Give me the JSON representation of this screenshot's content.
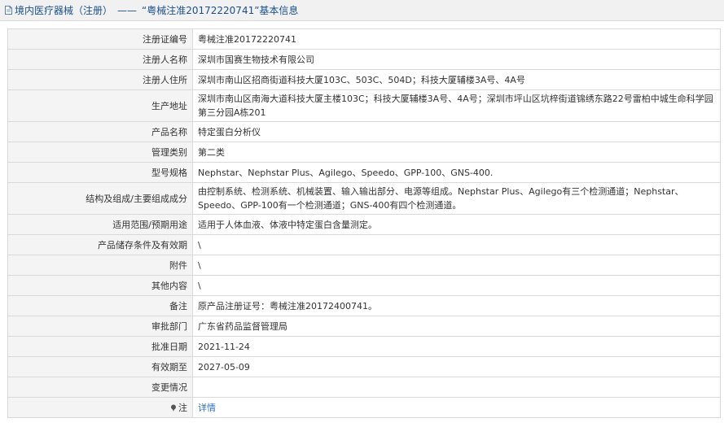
{
  "header": {
    "category": "境内医疗器械（注册）",
    "separator": "——",
    "record_title": "“粤械注准20172220741”基本信息"
  },
  "rows": [
    {
      "label": "注册证编号",
      "value": "粤械注准20172220741"
    },
    {
      "label": "注册人名称",
      "value": "深圳市国赛生物技术有限公司"
    },
    {
      "label": "注册人住所",
      "value": "深圳市南山区招商街道科技大厦103C、503C、504D；科技大厦辅楼3A号、4A号"
    },
    {
      "label": "生产地址",
      "value": "深圳市南山区南海大道科技大厦主楼103C；科技大厦辅楼3A号、4A号；深圳市坪山区坑梓街道锦绣东路22号雷柏中城生命科学园第三分园A栋201"
    },
    {
      "label": "产品名称",
      "value": "特定蛋白分析仪"
    },
    {
      "label": "管理类别",
      "value": "第二类"
    },
    {
      "label": "型号规格",
      "value": "Nephstar、Nephstar Plus、Agilego、Speedo、GPP-100、GNS-400."
    },
    {
      "label": "结构及组成/主要组成成分",
      "value": "由控制系统、检测系统、机械装置、输入输出部分、电源等组成。Nephstar Plus、Agilego有三个检测通道；Nephstar、Speedo、GPP-100有一个检测通道；GNS-400有四个检测通道。"
    },
    {
      "label": "适用范围/预期用途",
      "value": "适用于人体血液、体液中特定蛋白含量测定。"
    },
    {
      "label": "产品储存条件及有效期",
      "value": "\\"
    },
    {
      "label": "附件",
      "value": "\\"
    },
    {
      "label": "其他内容",
      "value": "\\"
    },
    {
      "label": "备注",
      "value": "原产品注册证号：粤械注准20172400741。"
    },
    {
      "label": "审批部门",
      "value": "广东省药品监督管理局"
    },
    {
      "label": "批准日期",
      "value": "2021-11-24"
    },
    {
      "label": "有效期至",
      "value": "2027-05-09"
    },
    {
      "label": "变更情况",
      "value": ""
    }
  ],
  "note_row": {
    "label": "注",
    "link_text": "详情"
  },
  "colors": {
    "header_text": "#1b4f8c",
    "link": "#2f6fc5",
    "label_bg": "#f4f4f4",
    "border": "#d9d9d9"
  }
}
